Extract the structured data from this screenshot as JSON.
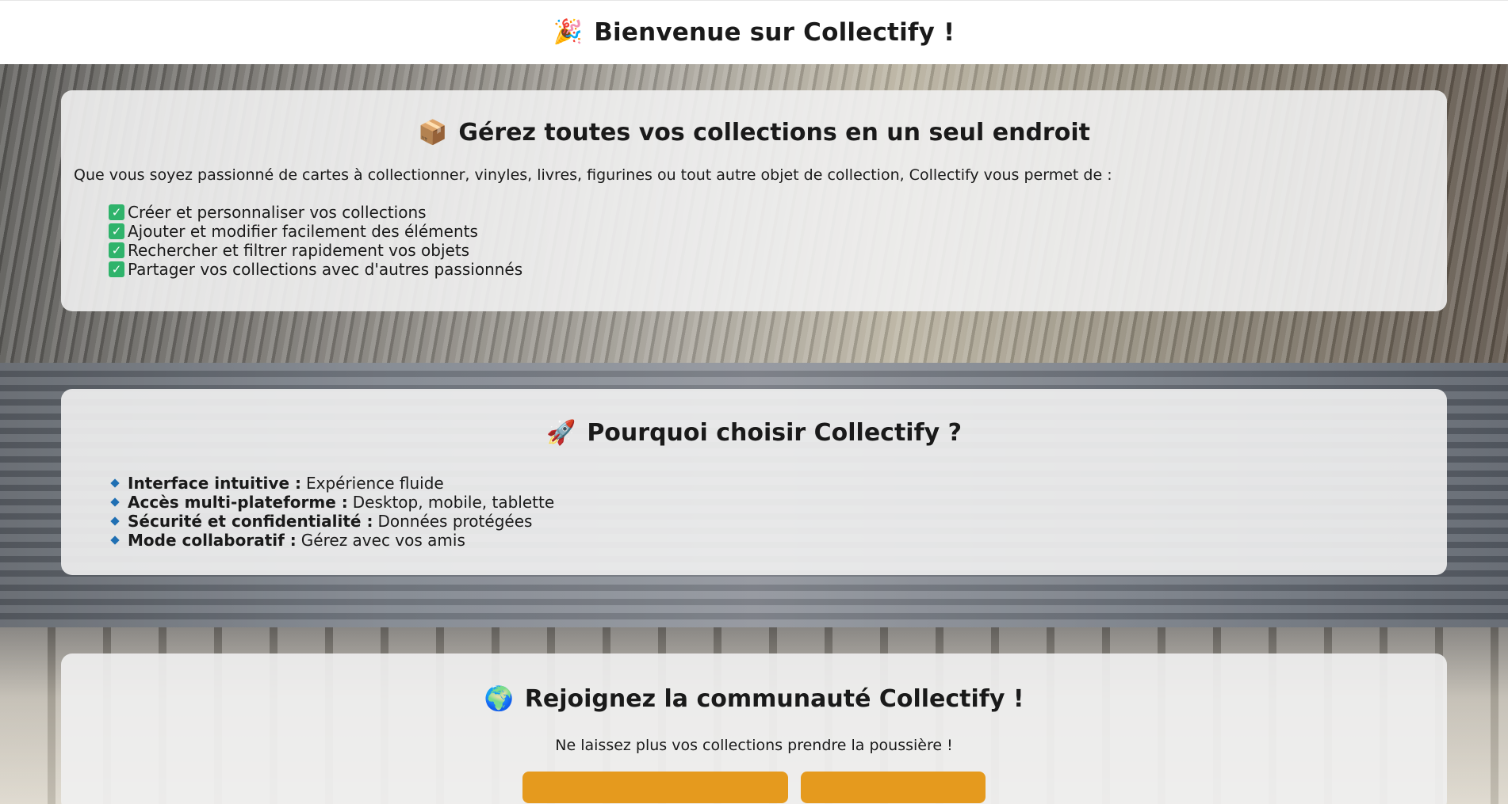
{
  "header": {
    "emoji": "🎉",
    "title": "Bienvenue sur Collectify !"
  },
  "manage": {
    "emoji": "📦",
    "title": "Gérez toutes vos collections en un seul endroit",
    "intro": "Que vous soyez passionné de cartes à collectionner, vinyles, livres, figurines ou tout autre objet de collection, Collectify vous permet de :",
    "features": [
      "Créer et personnaliser vos collections",
      "Ajouter et modifier facilement des éléments",
      "Rechercher et filtrer rapidement vos objets",
      "Partager vos collections avec d'autres passionnés"
    ]
  },
  "why": {
    "emoji": "🚀",
    "title": "Pourquoi choisir Collectify ?",
    "items": [
      {
        "label": "Interface intuitive :",
        "text": "Expérience fluide"
      },
      {
        "label": "Accès multi-plateforme :",
        "text": "Desktop, mobile, tablette"
      },
      {
        "label": "Sécurité et confidentialité :",
        "text": "Données protégées"
      },
      {
        "label": "Mode collaboratif :",
        "text": "Gérez avec vos amis"
      }
    ]
  },
  "join": {
    "emoji": "🌍",
    "title": "Rejoignez la communauté Collectify !",
    "tagline": "Ne laissez plus vos collections prendre la poussière !"
  },
  "colors": {
    "accent": "#e59a1e",
    "check": "#2fb36b",
    "bullet": "#1f6fb3"
  }
}
